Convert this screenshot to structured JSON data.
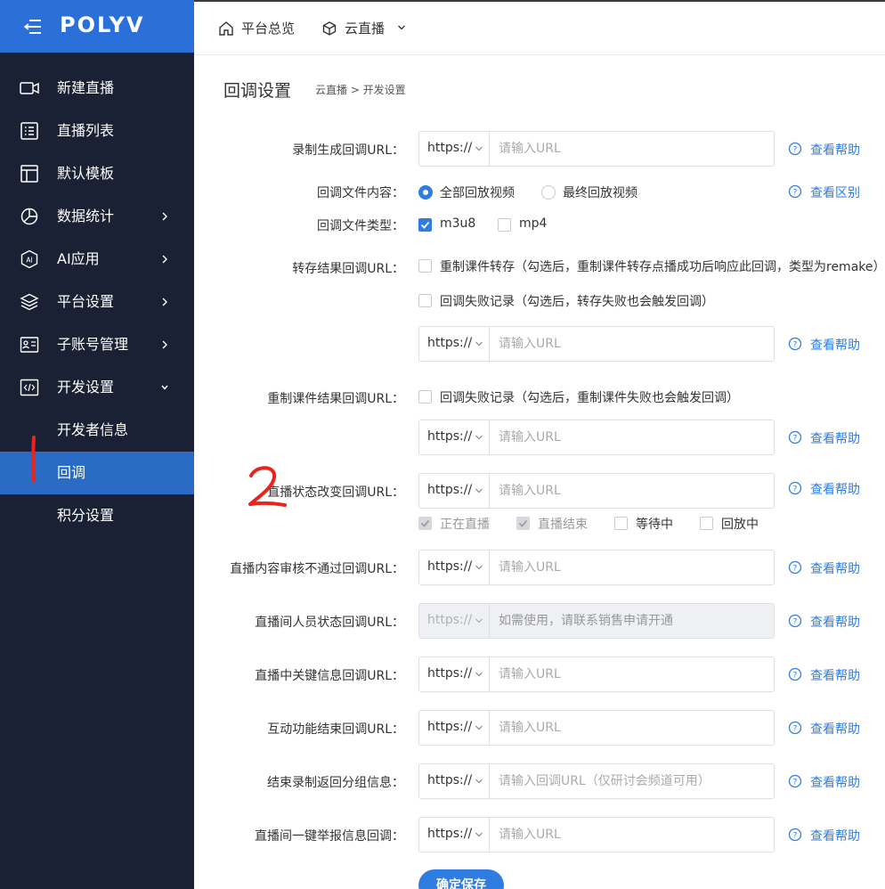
{
  "sidebar": {
    "logo": "POLYV",
    "items": [
      {
        "label": "新建直播"
      },
      {
        "label": "直播列表"
      },
      {
        "label": "默认模板"
      },
      {
        "label": "数据统计"
      },
      {
        "label": "AI应用"
      },
      {
        "label": "平台设置"
      },
      {
        "label": "子账号管理"
      },
      {
        "label": "开发设置"
      },
      {
        "label": "开发者信息"
      },
      {
        "label": "回调"
      },
      {
        "label": "积分设置"
      }
    ]
  },
  "topbar": {
    "tabs": [
      {
        "label": "平台总览"
      },
      {
        "label": "云直播"
      }
    ]
  },
  "page": {
    "title": "回调设置",
    "breadcrumb": "云直播 > 开发设置"
  },
  "form": {
    "protocol": "https://",
    "url_placeholder": "请输入URL",
    "help_text": "查看帮助",
    "diff_text": "查看区别",
    "rows": {
      "record": {
        "label": "录制生成回调URL："
      },
      "file_content": {
        "label": "回调文件内容：",
        "options": [
          "全部回放视频",
          "最终回放视频"
        ],
        "selected": "全部回放视频"
      },
      "file_type": {
        "label": "回调文件类型：",
        "options": [
          "m3u8",
          "mp4"
        ],
        "checked": [
          "m3u8"
        ]
      },
      "transcode": {
        "label": "转存结果回调URL：",
        "options": [
          "重制课件转存（勾选后，重制课件转存点播成功后响应此回调，类型为remake）",
          "回调失败记录（勾选后，转存失败也会触发回调）"
        ]
      },
      "remake": {
        "label": "重制课件结果回调URL：",
        "options": [
          "回调失败记录（勾选后，重制课件失败也会触发回调）"
        ]
      },
      "live_status": {
        "label": "直播状态改变回调URL：",
        "options": [
          "正在直播",
          "直播结束",
          "等待中",
          "回放中"
        ],
        "checked_disabled": [
          "正在直播",
          "直播结束"
        ]
      },
      "audit": {
        "label": "直播内容审核不通过回调URL："
      },
      "viewer_status": {
        "label": "直播间人员状态回调URL：",
        "placeholder": "如需使用，请联系销售申请开通"
      },
      "keyword": {
        "label": "直播中关键信息回调URL："
      },
      "interact_end": {
        "label": "互动功能结束回调URL："
      },
      "record_group": {
        "label": "结束录制返回分组信息：",
        "placeholder": "请输入回调URL（仅研讨会频道可用）"
      },
      "report": {
        "label": "直播间一键举报信息回调："
      }
    },
    "save_label": "确定保存"
  },
  "annotations": {
    "mark1": "1",
    "mark2": "2"
  },
  "colors": {
    "sidebar_bg": "#1b2134",
    "logo_bg": "#2b6fd9",
    "active_bg": "#2a6bc6",
    "accent": "#2f7de1",
    "annotation": "#e8241c"
  }
}
